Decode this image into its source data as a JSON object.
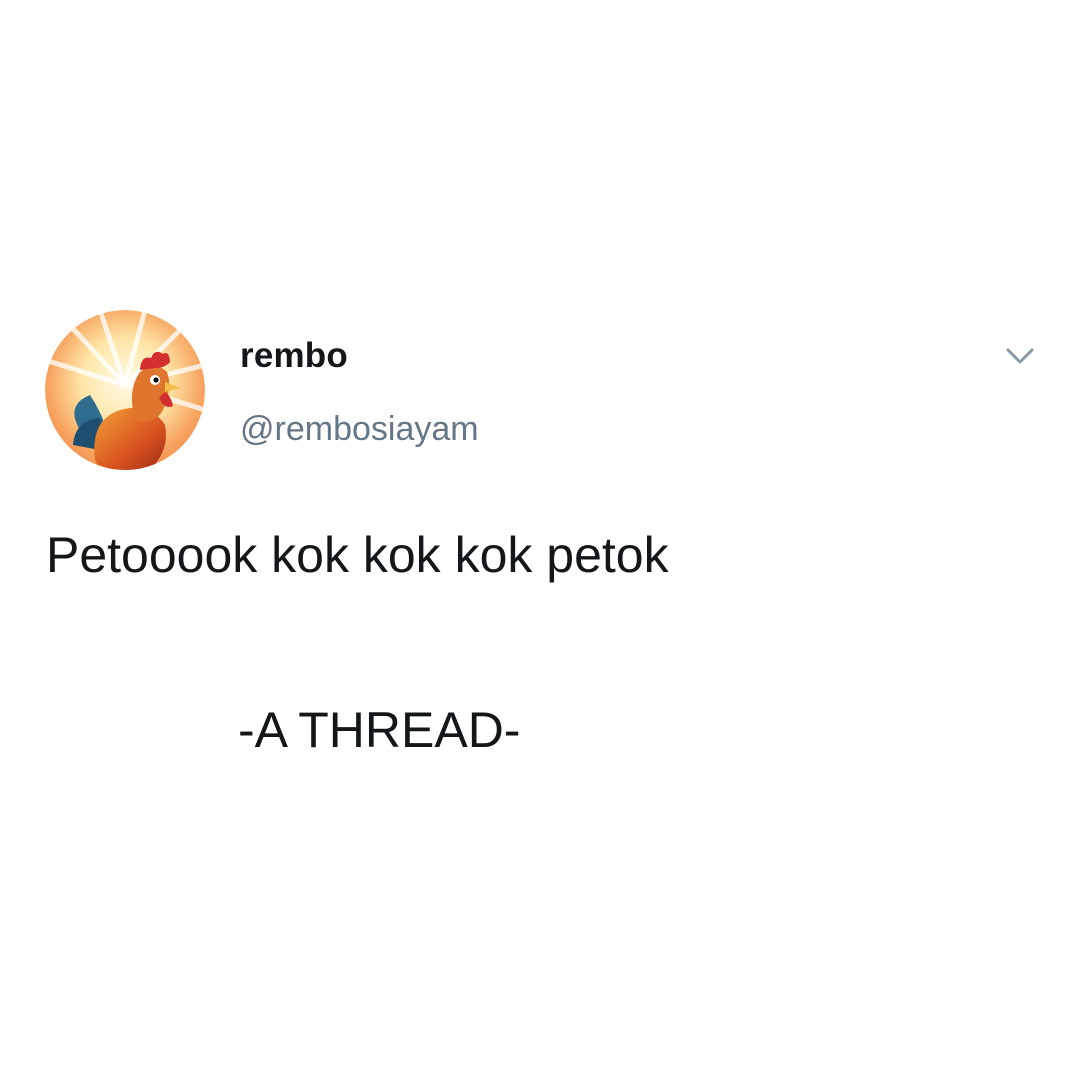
{
  "tweet": {
    "author": {
      "display_name": "rembo",
      "handle": "@rembosiayam",
      "avatar_icon": "rooster-avatar"
    },
    "menu_icon": "chevron-down-icon",
    "text_line_1": "Petooook kok kok kok petok",
    "text_line_2": "-A THREAD-"
  },
  "colors": {
    "background": "#ffffff",
    "text_primary": "#14171a",
    "text_secondary": "#657786",
    "caret": "#8899a6"
  }
}
